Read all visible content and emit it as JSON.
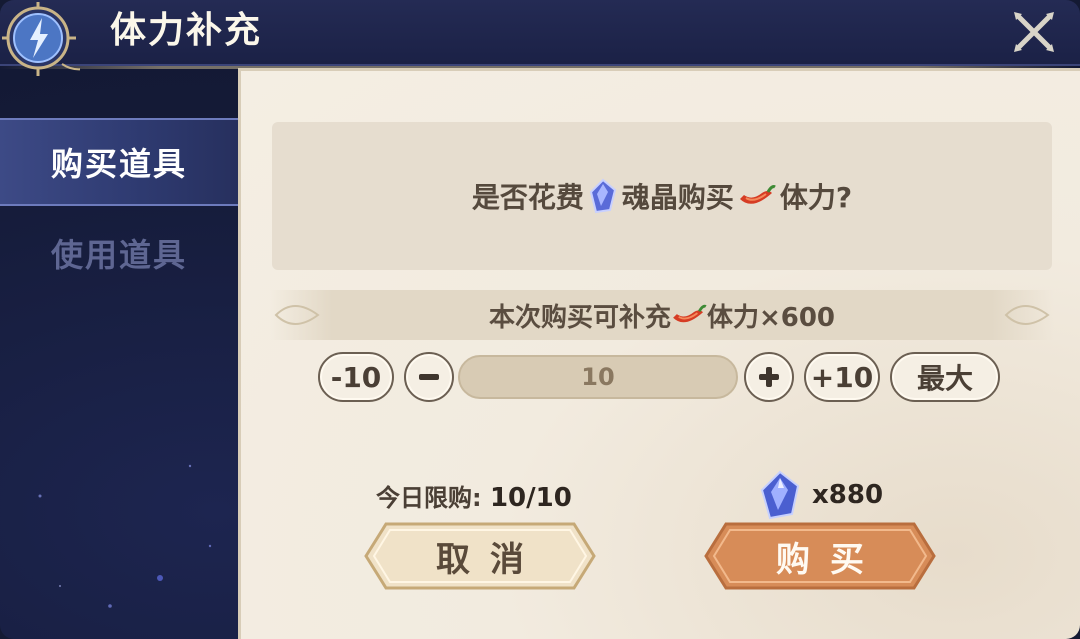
{
  "header": {
    "title": "体力补充"
  },
  "sidebar": {
    "tabs": [
      {
        "label": "购买道具",
        "active": true
      },
      {
        "label": "使用道具",
        "active": false
      }
    ]
  },
  "dialog": {
    "question": {
      "part1": "是否花费",
      "part2": "魂晶购买",
      "part3": "体力?"
    },
    "replenish": {
      "prefix": "本次购买可补充",
      "suffix": "体力×600"
    },
    "controls": {
      "minus10": "-10",
      "plus10": "+10",
      "max": "最大",
      "quantity": "10"
    },
    "daily_limit": {
      "label": "今日限购:",
      "value": "10/10"
    },
    "cost": {
      "amount": "x880"
    },
    "buttons": {
      "cancel": "取消",
      "buy": "购买"
    }
  },
  "icons": {
    "currency": "soul-crystal-icon",
    "stamina": "stamina-pepper-icon",
    "close": "close-x-icon",
    "emblem": "lightning-emblem-icon"
  },
  "colors": {
    "buy_button": "#d78c58",
    "cancel_button": "#f0e2c8",
    "panel_bg": "#f4eee3",
    "sidebar_bg": "#141a36"
  }
}
